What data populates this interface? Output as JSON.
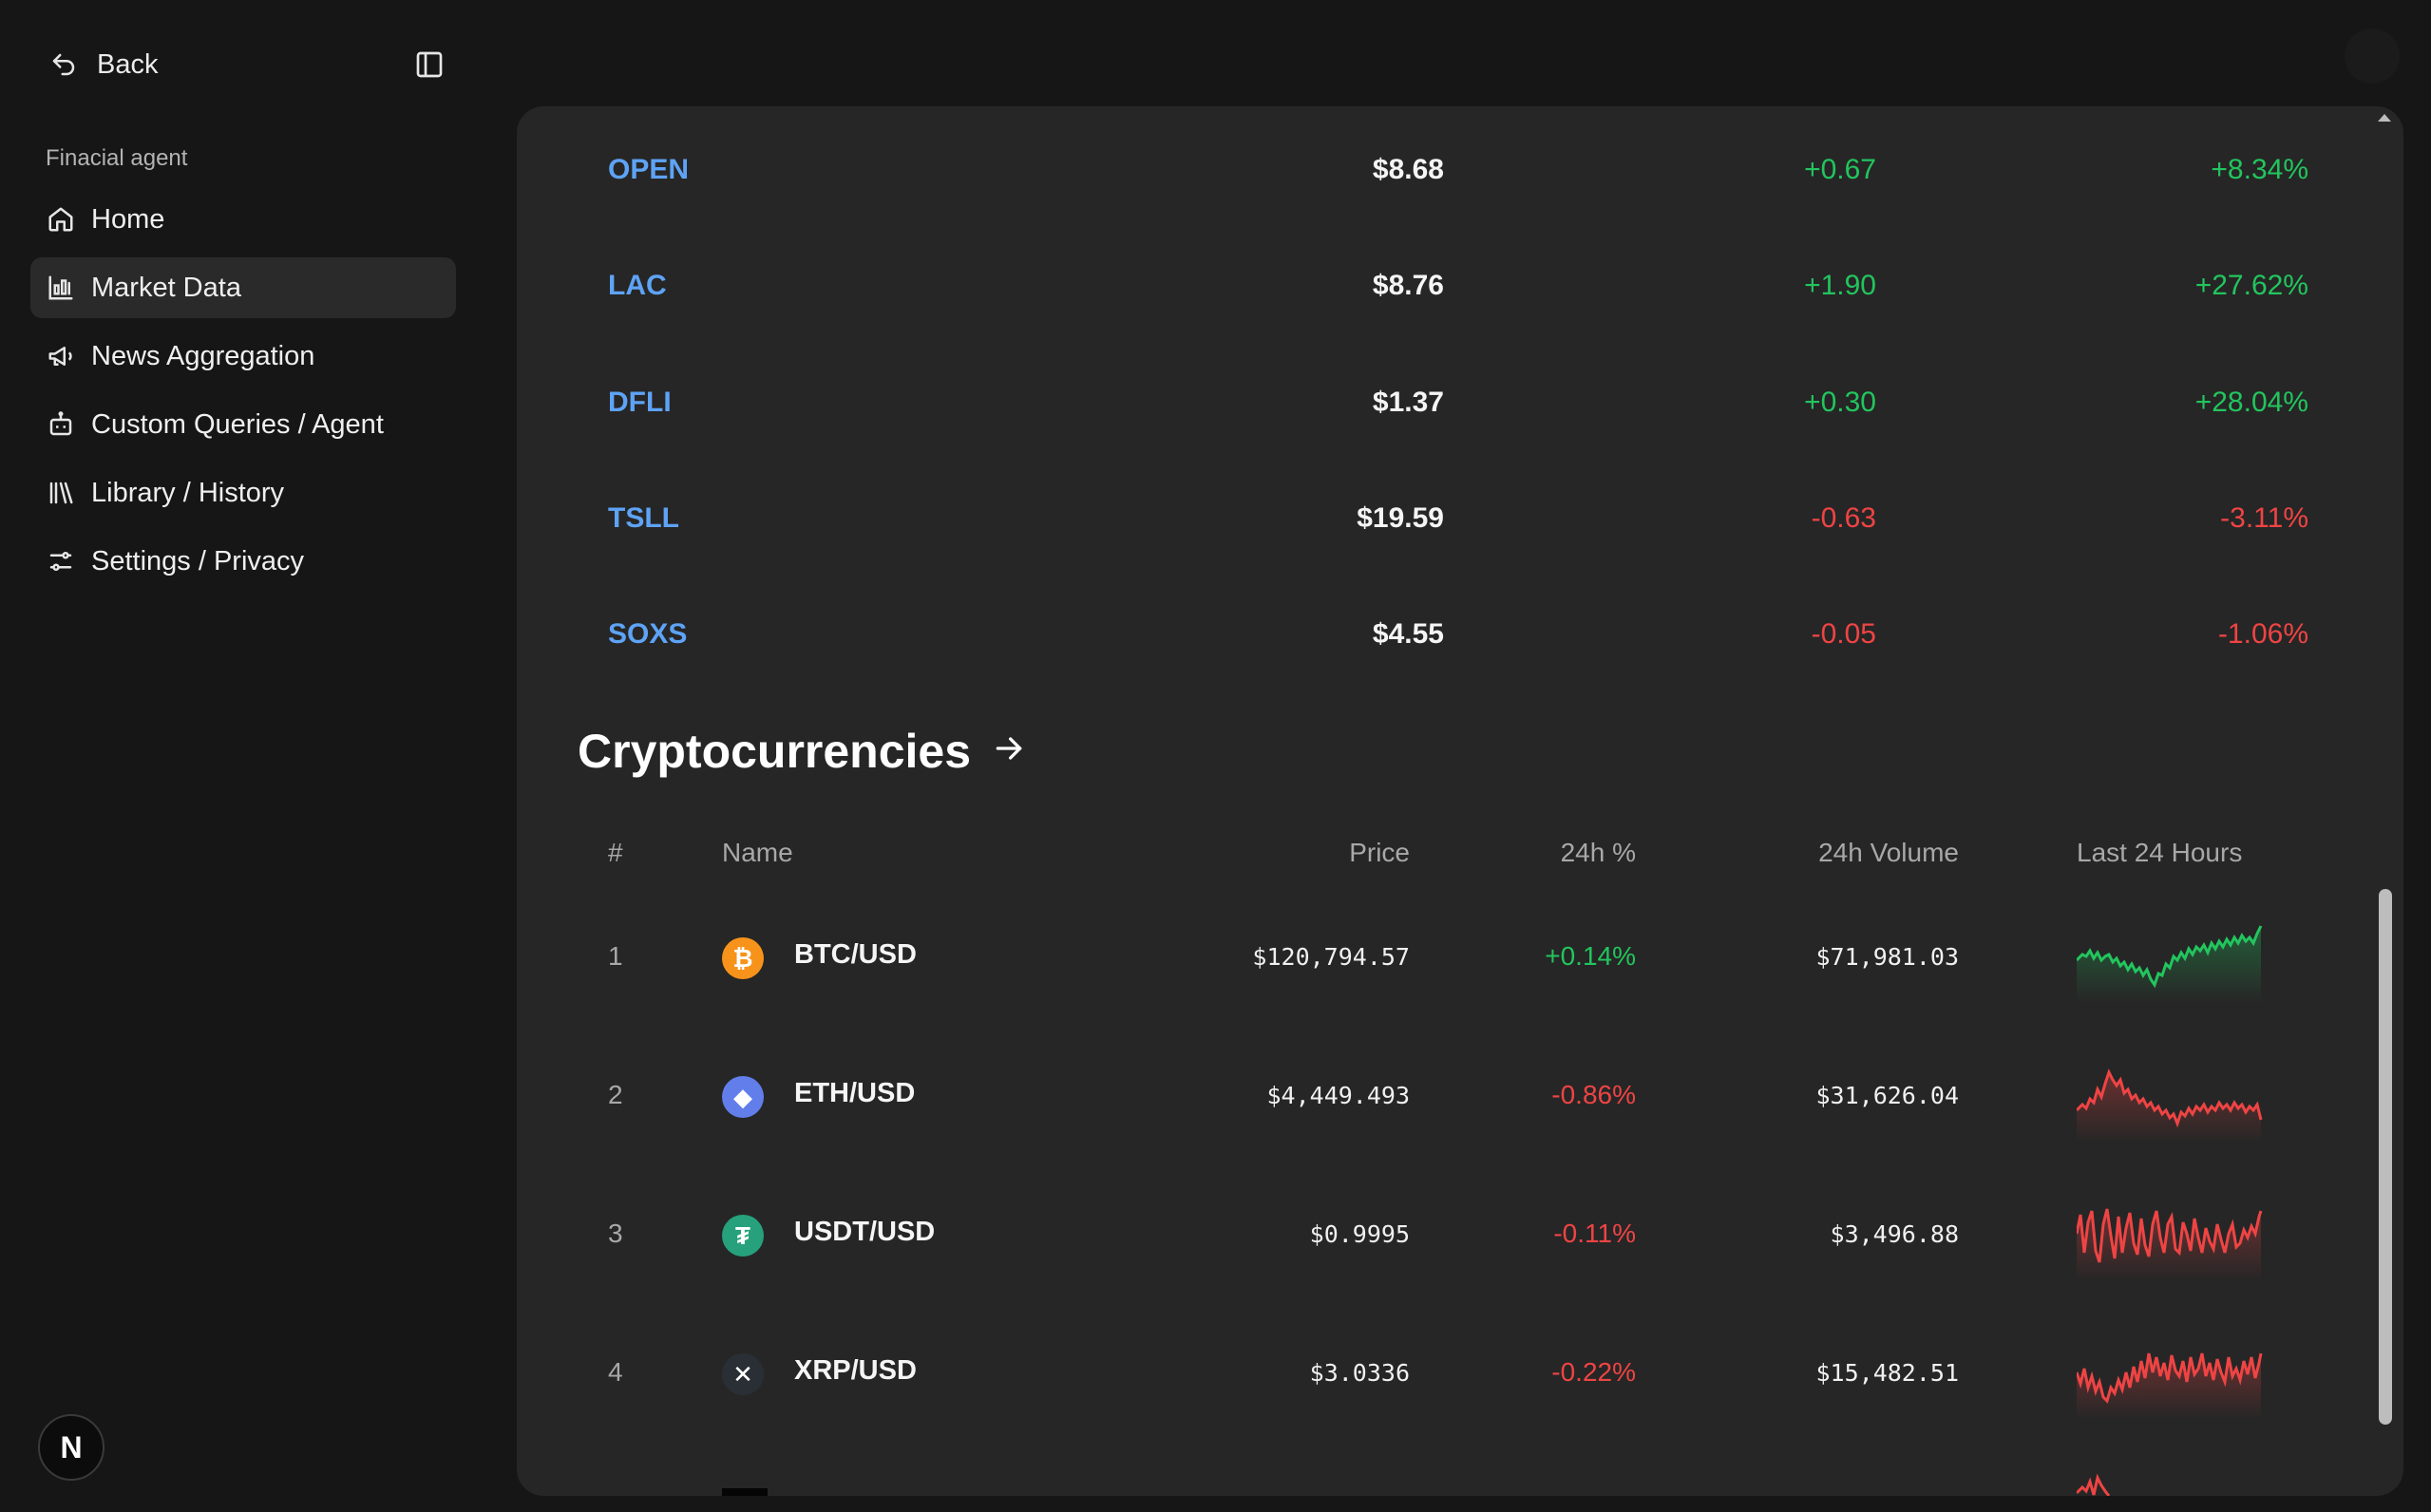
{
  "sidebar": {
    "back_label": "Back",
    "section_label": "Finacial agent",
    "items": [
      {
        "label": "Home",
        "icon": "home-icon"
      },
      {
        "label": "Market Data",
        "icon": "chart-icon",
        "active": true
      },
      {
        "label": "News Aggregation",
        "icon": "megaphone-icon"
      },
      {
        "label": "Custom Queries / Agent",
        "icon": "bot-icon"
      },
      {
        "label": "Library / History",
        "icon": "library-icon"
      },
      {
        "label": "Settings / Privacy",
        "icon": "sliders-icon"
      }
    ],
    "avatar_letter": "N"
  },
  "stocks": [
    {
      "symbol": "OPEN",
      "price": "$8.68",
      "change": "+0.67",
      "percent": "+8.34%",
      "direction": "up"
    },
    {
      "symbol": "LAC",
      "price": "$8.76",
      "change": "+1.90",
      "percent": "+27.62%",
      "direction": "up"
    },
    {
      "symbol": "DFLI",
      "price": "$1.37",
      "change": "+0.30",
      "percent": "+28.04%",
      "direction": "up"
    },
    {
      "symbol": "TSLL",
      "price": "$19.59",
      "change": "-0.63",
      "percent": "-3.11%",
      "direction": "down"
    },
    {
      "symbol": "SOXS",
      "price": "$4.55",
      "change": "-0.05",
      "percent": "-1.06%",
      "direction": "down"
    }
  ],
  "crypto": {
    "title": "Cryptocurrencies",
    "headers": {
      "rank": "#",
      "name": "Name",
      "price": "Price",
      "change": "24h %",
      "volume": "24h Volume",
      "chart": "Last 24 Hours"
    },
    "rows": [
      {
        "rank": "1",
        "pair": "BTC/USD",
        "price": "$120,794.57",
        "change": "+0.14%",
        "volume": "$71,981.03",
        "direction": "up",
        "icon": "bitcoin-icon",
        "icon_color": "#f7931a",
        "glyph": "₿"
      },
      {
        "rank": "2",
        "pair": "ETH/USD",
        "price": "$4,449.493",
        "change": "-0.86%",
        "volume": "$31,626.04",
        "direction": "down",
        "icon": "ethereum-icon",
        "icon_color": "#627eea",
        "glyph": "◆"
      },
      {
        "rank": "3",
        "pair": "USDT/USD",
        "price": "$0.9995",
        "change": "-0.11%",
        "volume": "$3,496.88",
        "direction": "down",
        "icon": "tether-icon",
        "icon_color": "#26a17b",
        "glyph": "₮"
      },
      {
        "rank": "4",
        "pair": "XRP/USD",
        "price": "$3.0336",
        "change": "-0.22%",
        "volume": "$15,482.51",
        "direction": "down",
        "icon": "xrp-icon",
        "icon_color": "#2a2f36",
        "glyph": "✕"
      }
    ]
  },
  "colors": {
    "up": "#22c55e",
    "down": "#ef4444",
    "link": "#5ea3f5"
  }
}
